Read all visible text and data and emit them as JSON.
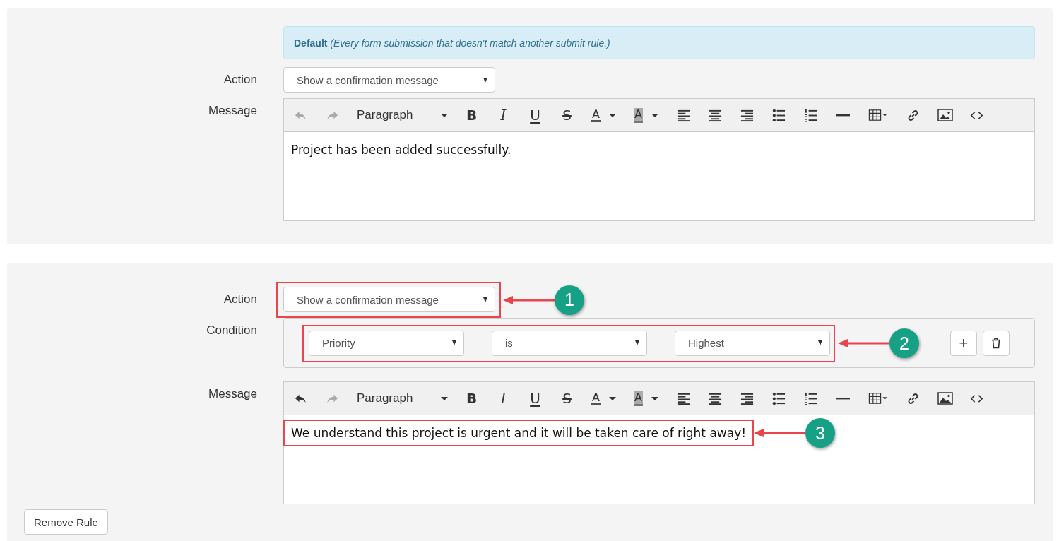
{
  "rules": [
    {
      "default_note": "**Default** *(Every form submission that doesn't match another submit rule.)*",
      "action": {
        "label": "Action",
        "value": "Show a confirmation message"
      },
      "message": {
        "label": "Message",
        "content": "Project has been added successfully.",
        "tools": [
          {
            "kind": "undo",
            "disabled": true
          },
          {
            "kind": "redo",
            "disabled": true
          },
          {
            "kind": "format",
            "label": "Paragraph",
            "disabled": false
          },
          {
            "kind": "bold",
            "label": "B",
            "disabled": false
          },
          {
            "kind": "italic",
            "label": "I",
            "disabled": false
          },
          {
            "kind": "underline",
            "label": "U",
            "disabled": false
          },
          {
            "kind": "strike",
            "label": "S",
            "disabled": false
          },
          {
            "kind": "text-color",
            "label": "A",
            "disabled": false
          },
          {
            "kind": "background-color",
            "label": "A",
            "disabled": false
          },
          {
            "kind": "align-left",
            "disabled": false
          },
          {
            "kind": "align-center",
            "disabled": false
          },
          {
            "kind": "align-right",
            "disabled": false
          },
          {
            "kind": "bullet-list",
            "disabled": false
          },
          {
            "kind": "numbered-list",
            "disabled": false
          },
          {
            "kind": "horizontal-rule",
            "disabled": false
          },
          {
            "kind": "table",
            "disabled": false
          },
          {
            "kind": "link",
            "disabled": false
          },
          {
            "kind": "image",
            "disabled": false
          },
          {
            "kind": "code",
            "disabled": false
          }
        ]
      }
    },
    {
      "action": {
        "label": "Action",
        "value": "Show a confirmation message",
        "annotation": "1"
      },
      "condition": {
        "label": "Condition",
        "field": "Priority",
        "operator": "is",
        "value": "Highest",
        "annotation": "2",
        "buttons": [
          {
            "kind": "add",
            "label": "+"
          },
          {
            "kind": "delete"
          }
        ]
      },
      "message": {
        "label": "Message",
        "content": "We understand this project is urgent and it will be taken care of right away!",
        "annotation": "3",
        "tools": [
          {
            "kind": "undo",
            "disabled": false
          },
          {
            "kind": "redo",
            "disabled": true
          },
          {
            "kind": "format",
            "label": "Paragraph",
            "disabled": false
          },
          {
            "kind": "bold",
            "label": "B",
            "disabled": false
          },
          {
            "kind": "italic",
            "label": "I",
            "disabled": false
          },
          {
            "kind": "underline",
            "label": "U",
            "disabled": false
          },
          {
            "kind": "strike",
            "label": "S",
            "disabled": false
          },
          {
            "kind": "text-color",
            "label": "A",
            "disabled": false
          },
          {
            "kind": "background-color",
            "label": "A",
            "disabled": false
          },
          {
            "kind": "align-left",
            "disabled": false
          },
          {
            "kind": "align-center",
            "disabled": false
          },
          {
            "kind": "align-right",
            "disabled": false
          },
          {
            "kind": "bullet-list",
            "disabled": false
          },
          {
            "kind": "numbered-list",
            "disabled": false
          },
          {
            "kind": "horizontal-rule",
            "disabled": false
          },
          {
            "kind": "table",
            "disabled": false
          },
          {
            "kind": "link",
            "disabled": false
          },
          {
            "kind": "image",
            "disabled": false
          },
          {
            "kind": "code",
            "disabled": false
          }
        ]
      },
      "remove_button": "Remove Rule"
    }
  ]
}
